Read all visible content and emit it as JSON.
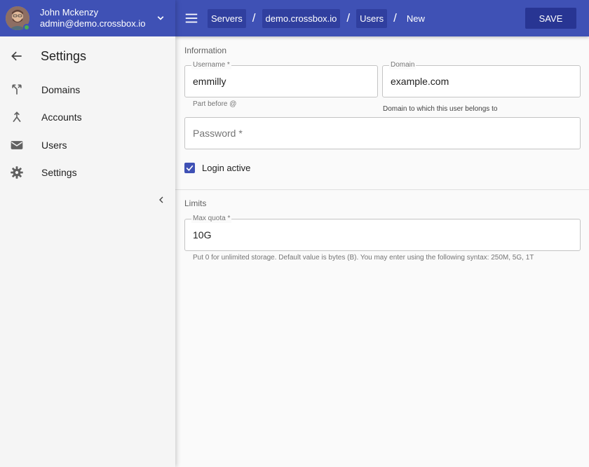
{
  "user": {
    "name": "John Mckenzy",
    "email": "admin@demo.crossbox.io",
    "status_color": "#4caf50"
  },
  "sidebar": {
    "title": "Settings",
    "items": [
      {
        "label": "Domains",
        "icon": "fork-icon"
      },
      {
        "label": "Accounts",
        "icon": "merge-icon"
      },
      {
        "label": "Users",
        "icon": "mail-icon"
      },
      {
        "label": "Settings",
        "icon": "gear-icon"
      }
    ]
  },
  "breadcrumb": [
    "Servers",
    "demo.crossbox.io",
    "Users",
    "New"
  ],
  "separator": "/",
  "toolbar": {
    "save_label": "SAVE"
  },
  "information": {
    "title": "Information",
    "username": {
      "label": "Username *",
      "value": "emmilly",
      "helper": "Part before @"
    },
    "domain": {
      "label": "Domain",
      "value": "example.com",
      "helper": "Domain to which this user belongs to"
    },
    "password": {
      "placeholder": "Password *"
    },
    "login_active": {
      "label": "Login active",
      "checked": true
    }
  },
  "limits": {
    "title": "Limits",
    "max_quota": {
      "label": "Max quota *",
      "value": "10G",
      "helper": "Put 0 for unlimited storage. Default value is bytes (B). You may enter using the following syntax: 250M, 5G, 1T"
    }
  },
  "colors": {
    "primary": "#3f51b5",
    "primary_dark": "#303f9f",
    "save": "#283593"
  }
}
